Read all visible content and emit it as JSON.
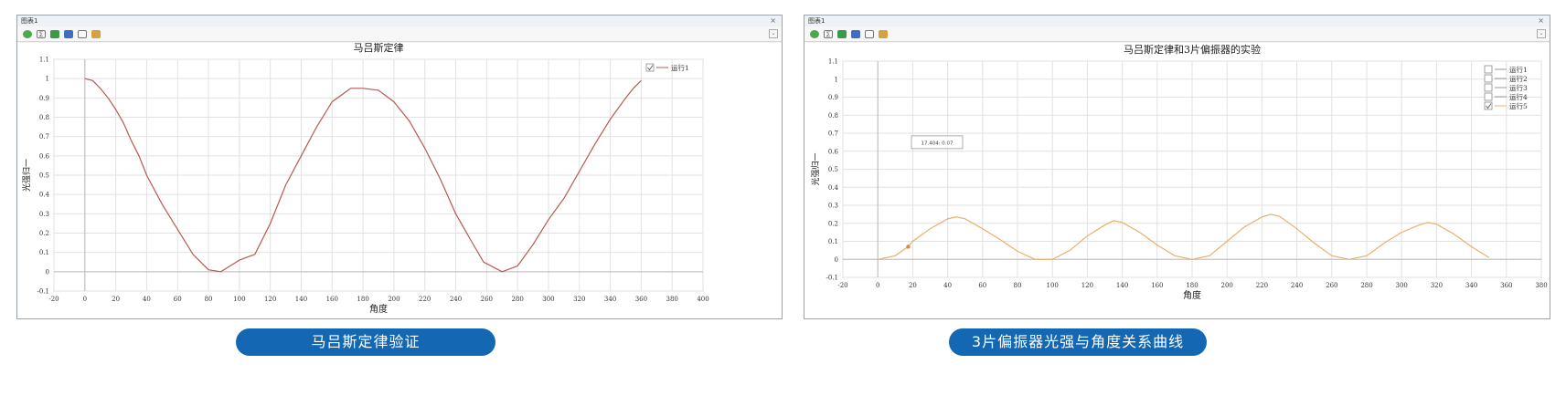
{
  "panels": [
    {
      "window_title": "图表1",
      "caption": "马吕斯定律验证",
      "chart_data": {
        "type": "line",
        "title": "马吕斯定律",
        "xlabel": "角度",
        "ylabel": "光强归一",
        "xlim": [
          -20,
          400
        ],
        "ylim": [
          -0.1,
          1.1
        ],
        "xticks": [
          -20,
          0,
          20,
          40,
          60,
          80,
          100,
          120,
          140,
          160,
          180,
          200,
          220,
          240,
          260,
          280,
          300,
          320,
          340,
          360,
          380,
          400
        ],
        "yticks": [
          "-0.1",
          "0",
          "0.1",
          "0.2",
          "0.3",
          "0.4",
          "0.5",
          "0.6",
          "0.7",
          "0.8",
          "0.9",
          "1",
          "1.1"
        ],
        "grid": true,
        "legend_position": "top-right",
        "series": [
          {
            "name": "运行1",
            "color": "#b85a50",
            "checked": true,
            "x": [
              0,
              5,
              10,
              15,
              20,
              25,
              30,
              35,
              40,
              50,
              60,
              70,
              80,
              88,
              100,
              110,
              120,
              130,
              140,
              150,
              160,
              172,
              180,
              190,
              200,
              210,
              220,
              230,
              240,
              250,
              258,
              270,
              280,
              290,
              300,
              310,
              320,
              330,
              340,
              350,
              355,
              360
            ],
            "y": [
              1,
              0.99,
              0.95,
              0.9,
              0.84,
              0.77,
              0.68,
              0.6,
              0.5,
              0.35,
              0.22,
              0.09,
              0.01,
              0,
              0.06,
              0.09,
              0.25,
              0.45,
              0.6,
              0.75,
              0.88,
              0.95,
              0.95,
              0.94,
              0.88,
              0.78,
              0.64,
              0.48,
              0.3,
              0.16,
              0.05,
              0,
              0.03,
              0.14,
              0.27,
              0.38,
              0.52,
              0.66,
              0.79,
              0.9,
              0.95,
              0.99
            ]
          }
        ]
      }
    },
    {
      "window_title": "图表1",
      "caption": "3片偏振器光强与角度关系曲线",
      "chart_data": {
        "type": "line",
        "title": "马吕斯定律和3片偏振器的实验",
        "xlabel": "角度",
        "ylabel": "光强归一",
        "xlim": [
          -20,
          380
        ],
        "ylim": [
          -0.1,
          1.1
        ],
        "xticks": [
          -20,
          0,
          20,
          40,
          60,
          80,
          100,
          120,
          140,
          160,
          180,
          200,
          220,
          240,
          260,
          280,
          300,
          320,
          340,
          360,
          380
        ],
        "yticks": [
          "-0.1",
          "0",
          "0.1",
          "0.2",
          "0.3",
          "0.4",
          "0.5",
          "0.6",
          "0.7",
          "0.8",
          "0.9",
          "1",
          "1.1"
        ],
        "grid": true,
        "legend_position": "top-right",
        "annotation": "17.404: 0.07",
        "marker": {
          "x": 17.404,
          "y": 0.07,
          "color": "#e08840"
        },
        "series": [
          {
            "name": "运行1",
            "checked": false
          },
          {
            "name": "运行2",
            "checked": false
          },
          {
            "name": "运行3",
            "checked": false
          },
          {
            "name": "运行4",
            "checked": false
          },
          {
            "name": "运行5",
            "color": "#e8b070",
            "checked": true,
            "x": [
              0,
              10,
              17.404,
              20,
              30,
              40,
              45,
              50,
              60,
              70,
              80,
              90,
              100,
              110,
              120,
              130,
              135,
              140,
              150,
              160,
              170,
              180,
              190,
              200,
              210,
              220,
              225,
              230,
              240,
              250,
              260,
              270,
              280,
              290,
              300,
              310,
              315,
              320,
              330,
              340,
              350
            ],
            "y": [
              0,
              0.02,
              0.07,
              0.1,
              0.17,
              0.225,
              0.235,
              0.225,
              0.17,
              0.11,
              0.045,
              0,
              0,
              0.05,
              0.13,
              0.19,
              0.215,
              0.205,
              0.15,
              0.08,
              0.02,
              0,
              0.02,
              0.1,
              0.18,
              0.235,
              0.25,
              0.24,
              0.17,
              0.09,
              0.02,
              0,
              0.02,
              0.09,
              0.15,
              0.19,
              0.205,
              0.195,
              0.14,
              0.07,
              0.01
            ]
          }
        ]
      }
    }
  ]
}
